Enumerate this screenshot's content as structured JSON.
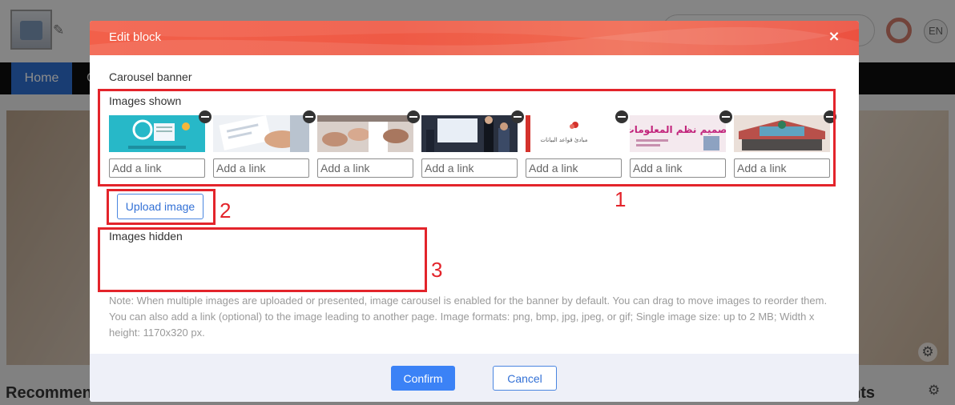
{
  "background": {
    "nav_home": "Home",
    "nav_second": "C",
    "lang": "EN",
    "recommend": "Recommen",
    "ents_tail": "nts"
  },
  "modal": {
    "title": "Edit block",
    "close": "×",
    "section_title": "Carousel banner",
    "images_shown_label": "Images shown",
    "images_hidden_label": "Images hidden",
    "link_placeholder": "Add a link",
    "upload_label": "Upload image",
    "note": "Note: When multiple images are uploaded or presented, image carousel is enabled for the banner by default. You can drag to move images to reorder them. You can also add a link (optional) to the image leading to another page. Image formats: png, bmp, jpg, jpeg, or gif; Single image size: up to 2 MB; Width x height: 1170x320 px.",
    "confirm_label": "Confirm",
    "cancel_label": "Cancel",
    "thumb_texts": {
      "t5": "مبادئ قواعد البيانات",
      "t6": "تصميم نظم المعلومات"
    }
  },
  "annotations": [
    "1",
    "2",
    "3"
  ],
  "colors": {
    "header_accent": "#ef5a45",
    "annotation_red": "#e3242b",
    "primary_blue": "#3b82f6"
  }
}
